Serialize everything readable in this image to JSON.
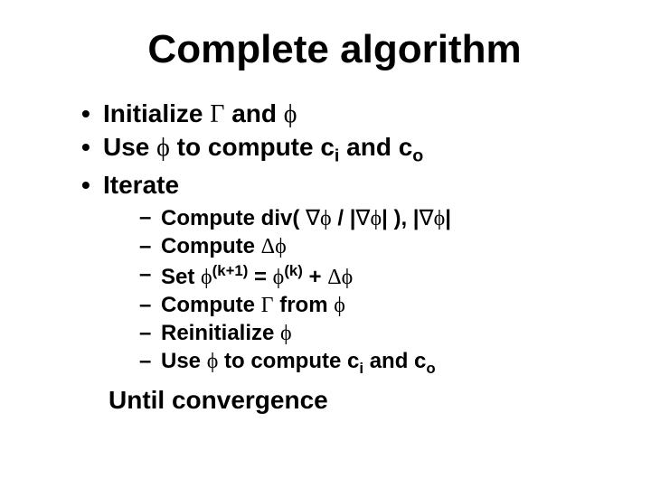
{
  "title": "Complete algorithm",
  "bullets": [
    {
      "pre": "Initialize ",
      "sym1": "Γ",
      "mid": " and ",
      "sym2": "ϕ",
      "post": ""
    },
    {
      "pre": "Use ",
      "sym1": "ϕ",
      "mid": " to compute c",
      "sub1": "i",
      "mid2": " and c",
      "sub2": "o",
      "post": ""
    },
    {
      "pre": "Iterate",
      "post": ""
    }
  ],
  "subbullets": [
    {
      "parts": [
        {
          "t": "Compute div( "
        },
        {
          "sym": "∇ϕ"
        },
        {
          "t": " / |"
        },
        {
          "sym": "∇ϕ"
        },
        {
          "t": "| ), |"
        },
        {
          "sym": "∇ϕ"
        },
        {
          "t": "|"
        }
      ]
    },
    {
      "parts": [
        {
          "t": "Compute "
        },
        {
          "sym": "Δϕ"
        }
      ]
    },
    {
      "parts": [
        {
          "t": "Set "
        },
        {
          "sym": "ϕ"
        },
        {
          "sup": "(k+1)"
        },
        {
          "t": " = "
        },
        {
          "sym": "ϕ"
        },
        {
          "sup": "(k)"
        },
        {
          "t": " + "
        },
        {
          "sym": "Δϕ"
        }
      ]
    },
    {
      "parts": [
        {
          "t": "Compute "
        },
        {
          "sym": "Γ"
        },
        {
          "t": " from "
        },
        {
          "sym": "ϕ"
        }
      ]
    },
    {
      "parts": [
        {
          "t": "Reinitialize "
        },
        {
          "sym": "ϕ"
        }
      ]
    },
    {
      "parts": [
        {
          "t": "Use "
        },
        {
          "sym": "ϕ"
        },
        {
          "t": " to compute c"
        },
        {
          "sub": "i"
        },
        {
          "t": " and c"
        },
        {
          "sub": "o"
        }
      ]
    }
  ],
  "until": "Until convergence"
}
